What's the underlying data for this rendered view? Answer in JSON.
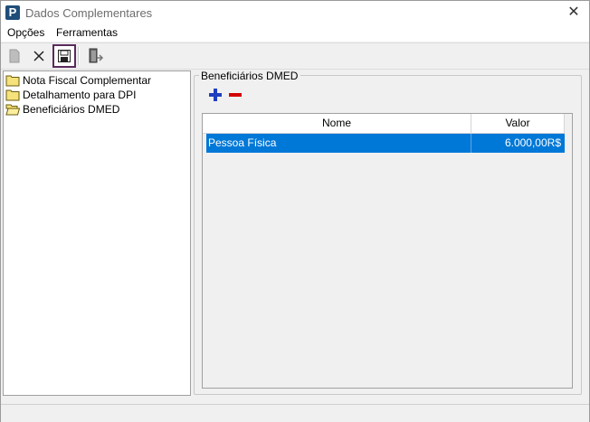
{
  "window": {
    "title": "Dados Complementares"
  },
  "menu": {
    "items": [
      "Opções",
      "Ferramentas"
    ]
  },
  "toolbar": {
    "icons": [
      "new-document-icon",
      "delete-x-icon",
      "save-icon",
      "exit-door-icon"
    ]
  },
  "tree": {
    "items": [
      {
        "label": "Nota Fiscal Complementar",
        "state": "closed"
      },
      {
        "label": "Detalhamento para DPI",
        "state": "closed"
      },
      {
        "label": "Beneficiários DMED",
        "state": "open"
      }
    ]
  },
  "panel": {
    "title": "Beneficiários DMED",
    "columns": [
      "Nome",
      "Valor"
    ],
    "rows": [
      {
        "nome": "Pessoa Física",
        "valor": "6.000,00R$"
      }
    ]
  },
  "colors": {
    "selection": "#0078d7",
    "add": "#1f3fbf",
    "remove": "#d40000"
  }
}
